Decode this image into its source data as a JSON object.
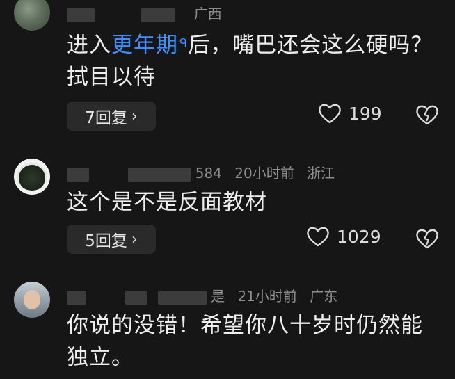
{
  "comments": [
    {
      "location": "广西",
      "text_before": "进入",
      "link_text": "更年期",
      "link_mark": "ᑫ",
      "text_after": "后，嘴巴还会这么硬吗？拭目以待",
      "replies_label": "7回复",
      "likes": "199"
    },
    {
      "handle_tail": "584",
      "time": "20小时前",
      "location": "浙江",
      "text": "这个是不是反面教材",
      "replies_label": "5回复",
      "likes": "1029"
    },
    {
      "handle_tail": "是",
      "time": "21小时前",
      "location": "广东",
      "text": "你说的没错！希望你八十岁时仍然能独立。"
    }
  ],
  "icons": {
    "reply_chevron": "chevron-right-icon",
    "like": "heart-outline-icon",
    "dislike": "broken-heart-icon"
  },
  "colors": {
    "background": "#161616",
    "link": "#3d8eff",
    "meta": "#8e8e8e",
    "reply_button": "#2a2a2a"
  }
}
